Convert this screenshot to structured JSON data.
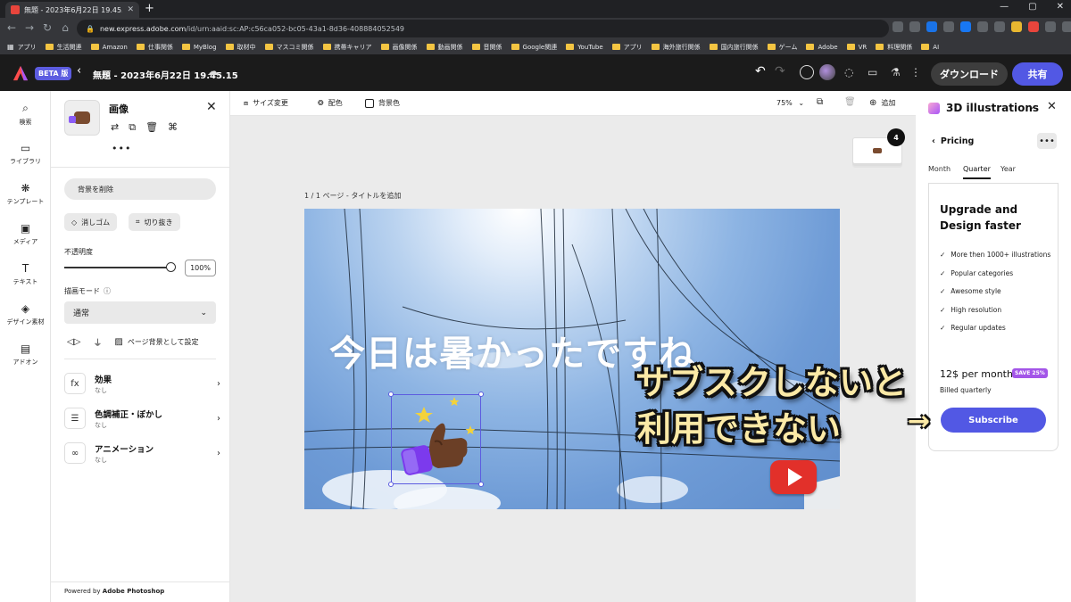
{
  "browser": {
    "tab_title": "無題 - 2023年6月22日 19.45.15",
    "url_host": "new.express.adobe.com",
    "url_path": "/id/urn:aaid:sc:AP:c56ca052-bc05-43a1-8d36-408884052549",
    "bookmarks": [
      "アプリ",
      "生活関連",
      "Amazon",
      "仕事関係",
      "MyBlog",
      "取材中",
      "マスコミ関係",
      "携帯キャリア",
      "画像関係",
      "動画関係",
      "音関係",
      "Google関連",
      "YouTube",
      "アプリ",
      "海外旅行関係",
      "国内旅行関係",
      "ゲーム",
      "Adobe",
      "VR",
      "料理関係",
      "AI"
    ]
  },
  "appbar": {
    "beta_label": "BETA 版",
    "doc_title": "無題 - 2023年6月22日 19.45.15",
    "download_label": "ダウンロード",
    "share_label": "共有",
    "brand_color": "#5258e4"
  },
  "rail": {
    "items": [
      {
        "label": "検索",
        "icon": "search-icon"
      },
      {
        "label": "ライブラリ",
        "icon": "folder-icon"
      },
      {
        "label": "テンプレート",
        "icon": "template-icon"
      },
      {
        "label": "メディア",
        "icon": "media-icon"
      },
      {
        "label": "テキスト",
        "icon": "text-icon"
      },
      {
        "label": "デザイン素材",
        "icon": "shapes-icon"
      },
      {
        "label": "アドオン",
        "icon": "addon-icon"
      }
    ]
  },
  "props": {
    "title": "画像",
    "remove_bg_label": "背景を削除",
    "eraser_label": "消しゴム",
    "crop_label": "切り抜き",
    "opacity_label": "不透明度",
    "opacity_value": "100%",
    "opacity_fraction": 1.0,
    "blend_label": "描画モード",
    "blend_value": "通常",
    "page_bg_label": "ページ背景として設定",
    "effects": [
      {
        "icon": "fx-icon",
        "title": "効果",
        "sub": "なし"
      },
      {
        "icon": "sliders-icon",
        "title": "色調補正・ぼかし",
        "sub": "なし"
      },
      {
        "icon": "animation-icon",
        "title": "アニメーション",
        "sub": "なし"
      }
    ],
    "powered_prefix": "Powered by ",
    "powered_brand": "Adobe Photoshop"
  },
  "canvas": {
    "resize_label": "サイズ変更",
    "color_label": "配色",
    "bg_label": "背景色",
    "zoom": "75%",
    "add_label": "追加",
    "page_count": "4",
    "page_label": "1 / 1 ページ - タイトルを追加",
    "headline": "今日は暑かったですね"
  },
  "rightpanel": {
    "title": "3D illustrations",
    "pricing": "Pricing",
    "tabs": [
      {
        "label": "Month",
        "active": false
      },
      {
        "label": "Quarter",
        "active": true
      },
      {
        "label": "Year",
        "active": false
      }
    ],
    "card_title": "Upgrade and Design faster",
    "features": [
      "More then 1000+ illustrations",
      "Popular categories",
      "Awesome style",
      "High resolution",
      "Regular updates"
    ],
    "price": "12$ per month",
    "save_badge": "SAVE 25%",
    "billed": "Billed quarterly",
    "subscribe_label": "Subscribe"
  },
  "overlay": {
    "line1": "サブスクしないと",
    "line2": "利用できない",
    "arrow": "→"
  }
}
